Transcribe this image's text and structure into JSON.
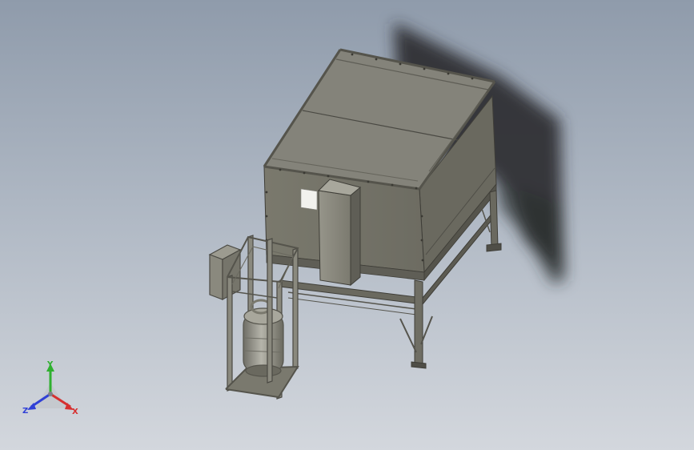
{
  "viewport": {
    "background_top": "#8f9bab",
    "background_bottom": "#d3d7dd"
  },
  "model": {
    "enclosure_color": "#807f73",
    "frame_color": "#5c5b52",
    "tank_color": "#9a998f"
  },
  "triad": {
    "y_label": "Y",
    "x_label": "X",
    "z_label": "Z",
    "x_color": "#d63030",
    "y_color": "#2fb02f",
    "z_color": "#3040d6"
  }
}
